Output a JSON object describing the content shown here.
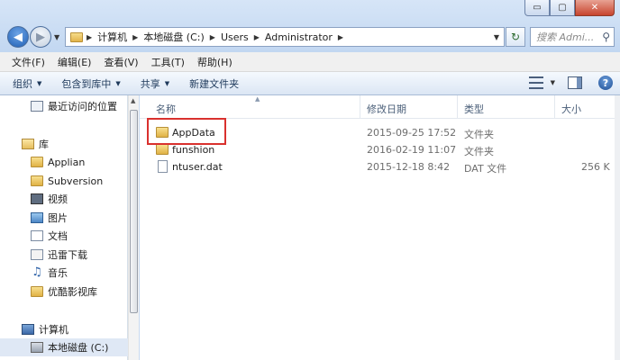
{
  "window": {
    "minimize_label": "▭",
    "maximize_label": "▢",
    "close_label": "✕"
  },
  "address": {
    "crumbs": [
      "计算机",
      "本地磁盘 (C:)",
      "Users",
      "Administrator"
    ]
  },
  "search": {
    "placeholder": "搜索 Admi..."
  },
  "menu": {
    "items": [
      "文件(F)",
      "编辑(E)",
      "查看(V)",
      "工具(T)",
      "帮助(H)"
    ]
  },
  "toolbar": {
    "organize": "组织",
    "include_in_library": "包含到库中",
    "share": "共享",
    "new_folder": "新建文件夹"
  },
  "nav": {
    "recent": "最近访问的位置",
    "libraries": "库",
    "items": [
      "Applian",
      "Subversion",
      "视频",
      "图片",
      "文档",
      "迅雷下载",
      "音乐",
      "优酷影视库"
    ],
    "computer": "计算机",
    "local_disk": "本地磁盘 (C:)"
  },
  "columns": {
    "name": "名称",
    "modified": "修改日期",
    "type": "类型",
    "size": "大小"
  },
  "files": [
    {
      "name": "AppData",
      "modified": "2015-09-25 17:52",
      "type": "文件夹",
      "size": ""
    },
    {
      "name": "funshion",
      "modified": "2016-02-19 11:07",
      "type": "文件夹",
      "size": ""
    },
    {
      "name": "ntuser.dat",
      "modified": "2015-12-18 8:42",
      "type": "DAT 文件",
      "size": "256 K"
    }
  ],
  "colors": {
    "highlight": "#d9312e",
    "folder": "#e0b245"
  }
}
